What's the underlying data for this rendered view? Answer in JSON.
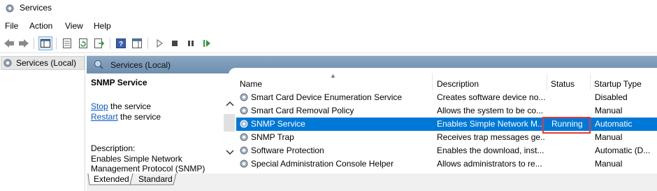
{
  "window": {
    "title": "Services"
  },
  "menu": [
    "File",
    "Action",
    "View",
    "Help"
  ],
  "toolbar": {
    "icons": [
      "back-arrow-icon",
      "forward-arrow-icon",
      "show-hide-console-tree-icon",
      "properties-icon",
      "refresh-icon",
      "export-list-icon",
      "help-icon",
      "show-action-pane-icon",
      "start-service-icon",
      "stop-service-icon",
      "pause-service-icon",
      "resume-service-icon"
    ]
  },
  "tree": {
    "root_label": "Services (Local)"
  },
  "pane": {
    "header": "Services (Local)",
    "selected_service": "SNMP Service",
    "stop_link": "Stop",
    "stop_suffix": " the service",
    "restart_link": "Restart",
    "restart_suffix": " the service",
    "description_label": "Description:",
    "description_text": "Enables Simple Network Management Protocol (SNMP)"
  },
  "columns": [
    "Name",
    "Description",
    "Status",
    "Startup Type"
  ],
  "rows": [
    {
      "name": "Smart Card Device Enumeration Service",
      "description": "Creates software device no...",
      "status": "",
      "startup": "Disabled",
      "selected": false
    },
    {
      "name": "Smart Card Removal Policy",
      "description": "Allows the system to be co...",
      "status": "",
      "startup": "Manual",
      "selected": false
    },
    {
      "name": "SNMP Service",
      "description": "Enables Simple Network M...",
      "status": "Running",
      "startup": "Automatic",
      "selected": true
    },
    {
      "name": "SNMP Trap",
      "description": "Receives trap messages ge...",
      "status": "",
      "startup": "Manual",
      "selected": false
    },
    {
      "name": "Software Protection",
      "description": "Enables the download, inst...",
      "status": "",
      "startup": "Automatic (D...",
      "selected": false
    },
    {
      "name": "Special Administration Console Helper",
      "description": "Allows administrators to re...",
      "status": "",
      "startup": "Manual",
      "selected": false
    }
  ],
  "tabs": [
    "Extended",
    "Standard"
  ],
  "colors": {
    "selection": "#0078d7",
    "highlight_box": "#e53935",
    "link": "#0b57d0"
  }
}
